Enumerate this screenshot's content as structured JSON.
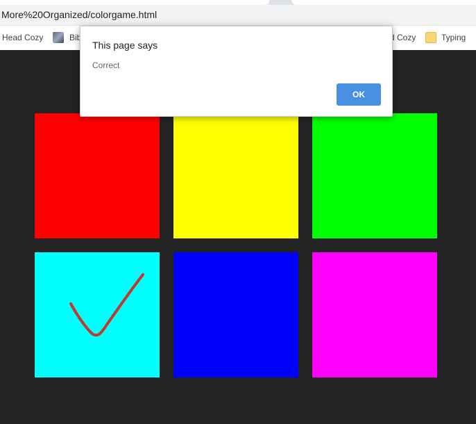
{
  "browser": {
    "address": "More%20Organized/colorgame.html",
    "bookmarks": [
      {
        "label": "Head Cozy",
        "icon": "none"
      },
      {
        "label": "Bib",
        "icon": "image-thumbnail-icon"
      },
      {
        "label": "d Cozy",
        "icon": "none"
      },
      {
        "label": "Typing",
        "icon": "folder-icon"
      }
    ]
  },
  "game": {
    "background": "#232323",
    "squares": [
      {
        "name": "red-square",
        "color": "#ff0000"
      },
      {
        "name": "yellow-square",
        "color": "#ffff00"
      },
      {
        "name": "green-square",
        "color": "#00ff00"
      },
      {
        "name": "cyan-square",
        "color": "#00ffff"
      },
      {
        "name": "blue-square",
        "color": "#0000ff"
      },
      {
        "name": "magenta-square",
        "color": "#ff00ff"
      }
    ],
    "check_mark_color": "#c0392b"
  },
  "dialog": {
    "title": "This page says",
    "message": "Correct",
    "ok_label": "OK",
    "ok_color": "#4a90e2"
  }
}
